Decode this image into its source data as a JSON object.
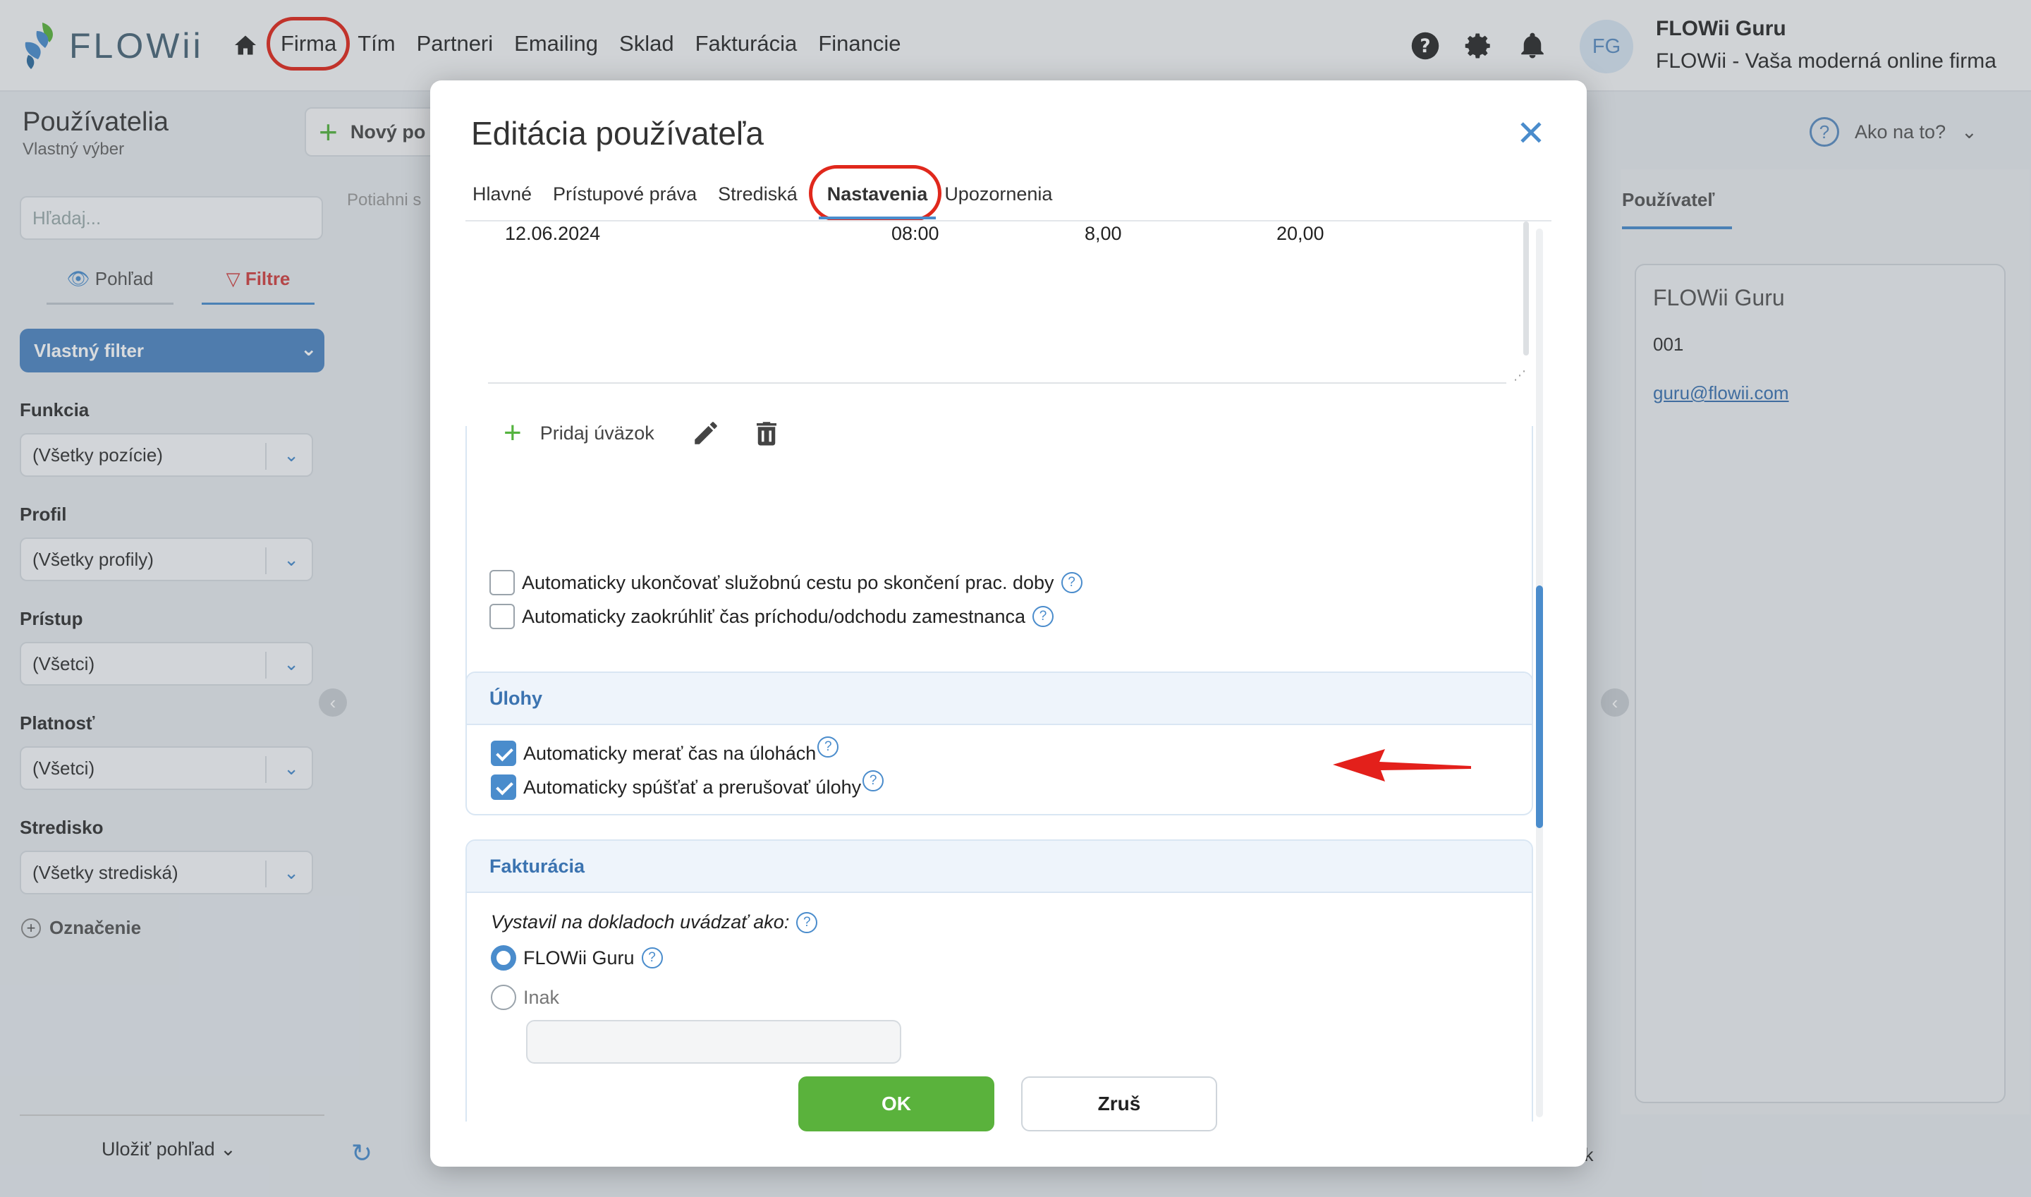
{
  "topbar": {
    "logo_text": "FLOWii",
    "nav": [
      "Firma",
      "Tím",
      "Partneri",
      "Emailing",
      "Sklad",
      "Fakturácia",
      "Financie"
    ],
    "user_initials": "FG",
    "user_name": "FLOWii Guru",
    "user_company": "FLOWii - Vaša moderná online firma"
  },
  "page": {
    "title": "Používatelia",
    "subtitle": "Vlastný výber",
    "new_button": "Nový po",
    "drag_hint": "Potiahni s",
    "help_label": "Ako na to?"
  },
  "sidebar": {
    "search_placeholder": "Hľadaj...",
    "tab_view": "Pohľad",
    "tab_filters": "Filtre",
    "custom_filter": "Vlastný filter",
    "filters": [
      {
        "label": "Funkcia",
        "value": "(Všetky pozície)"
      },
      {
        "label": "Profil",
        "value": "(Všetky profily)"
      },
      {
        "label": "Prístup",
        "value": "(Všetci)"
      },
      {
        "label": "Platnosť",
        "value": "(Všetci)"
      },
      {
        "label": "Stredisko",
        "value": "(Všetky strediská)"
      }
    ],
    "tag_label": "Označenie",
    "save_view": "Uložiť pohľad"
  },
  "right_panel": {
    "tab": "Používateľ",
    "name": "FLOWii Guru",
    "number": "001",
    "email": "guru@flowii.com",
    "bottom_text": "ek"
  },
  "modal": {
    "title": "Editácia používateľa",
    "tabs": [
      "Hlavné",
      "Prístupové práva",
      "Strediská",
      "Nastavenia",
      "Upozornenia"
    ],
    "active_tab": "Nastavenia",
    "work_row": {
      "date": "12.06.2024",
      "time": "08:00",
      "hours": "8,00",
      "value": "20,00"
    },
    "add_workload": "Pridaj úväzok",
    "checkboxes_general": [
      {
        "label": "Automaticky ukončovať služobnú cestu po skončení prac. doby",
        "checked": false
      },
      {
        "label": "Automaticky zaokrúhliť čas príchodu/odchodu zamestnanca",
        "checked": false
      }
    ],
    "tasks_section": {
      "title": "Úlohy",
      "checkboxes": [
        {
          "label": "Automaticky merať čas na úlohách",
          "checked": true
        },
        {
          "label": "Automaticky spúšťať a prerušovať úlohy",
          "checked": true
        }
      ]
    },
    "invoicing_section": {
      "title": "Fakturácia",
      "issuer_label": "Vystavil na dokladoch uvádzať ako:",
      "options": [
        {
          "label": "FLOWii Guru",
          "selected": true
        },
        {
          "label": "Inak",
          "selected": false
        }
      ],
      "other_value": ""
    },
    "ok": "OK",
    "cancel": "Zruš"
  },
  "colors": {
    "accent": "#4a8ccc",
    "ok_green": "#5ab23c",
    "highlight_red": "#e0281c"
  }
}
